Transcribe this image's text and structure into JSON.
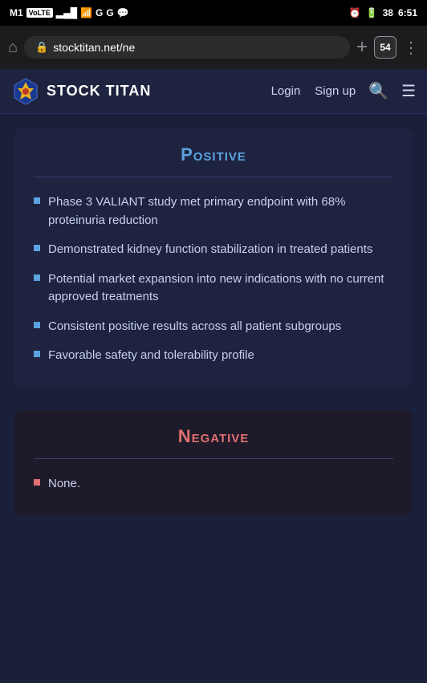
{
  "status_bar": {
    "carrier": "M1",
    "volte": "VoLTE",
    "signal_bars": "▂▄▆",
    "wifi": "wifi",
    "g_icons": "G G",
    "whatsapp": "wa",
    "alarm": "⏰",
    "battery": "38",
    "time": "6:51"
  },
  "browser": {
    "url": "stocktitan.net/ne",
    "tab_count": "54",
    "new_tab_label": "+",
    "menu_label": "⋮"
  },
  "nav": {
    "logo_text": "STOCK TITAN",
    "login_label": "Login",
    "signup_label": "Sign up"
  },
  "positive_section": {
    "title": "Positive",
    "bullets": [
      "Phase 3 VALIANT study met primary endpoint with 68% proteinuria reduction",
      "Demonstrated kidney function stabilization in treated patients",
      "Potential market expansion into new indications with no current approved treatments",
      "Consistent positive results across all patient subgroups",
      "Favorable safety and tolerability profile"
    ]
  },
  "negative_section": {
    "title": "Negative",
    "bullets": [
      "None."
    ]
  }
}
